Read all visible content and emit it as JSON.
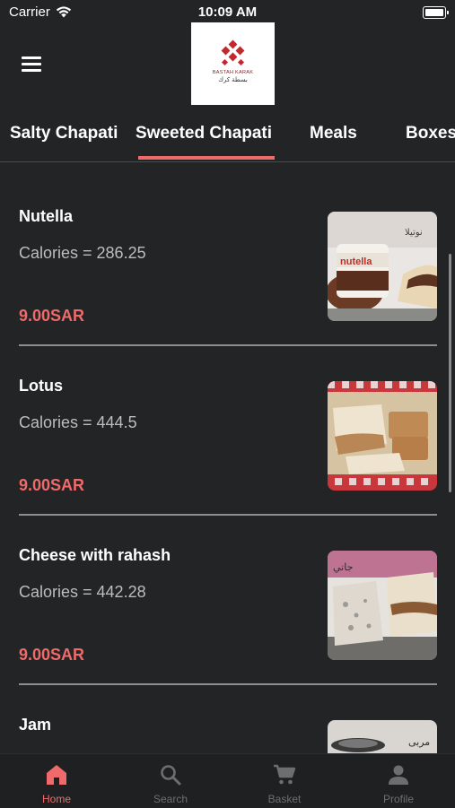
{
  "status_bar": {
    "carrier": "Carrier",
    "time": "10:09 AM"
  },
  "header": {
    "logo_text": "BASTAH KARAK",
    "logo_text_ar": "بسطة كرك"
  },
  "tabs": [
    {
      "label": "Salty Chapati",
      "active": false
    },
    {
      "label": "Sweeted Chapati",
      "active": true
    },
    {
      "label": "Meals",
      "active": false
    },
    {
      "label": "Boxes",
      "active": false
    }
  ],
  "items": [
    {
      "name": "Nutella",
      "calories": "Calories = 286.25",
      "price": "9.00SAR",
      "image_icon": "nutella-chapati-photo"
    },
    {
      "name": "Lotus",
      "calories": "Calories = 444.5",
      "price": "9.00SAR",
      "image_icon": "lotus-chapati-photo"
    },
    {
      "name": "Cheese with rahash",
      "calories": "Calories = 442.28",
      "price": "9.00SAR",
      "image_icon": "cheese-rahash-chapati-photo"
    },
    {
      "name": "Jam",
      "calories": "",
      "price": "",
      "image_icon": "jam-chapati-photo"
    }
  ],
  "tabbar": [
    {
      "label": "Home",
      "icon": "home-icon",
      "active": true
    },
    {
      "label": "Search",
      "icon": "search-icon",
      "active": false
    },
    {
      "label": "Basket",
      "icon": "cart-icon",
      "active": false
    },
    {
      "label": "Profile",
      "icon": "profile-icon",
      "active": false
    }
  ],
  "colors": {
    "accent": "#ef6a6a",
    "background": "#232426",
    "brand": "#c2282e"
  }
}
